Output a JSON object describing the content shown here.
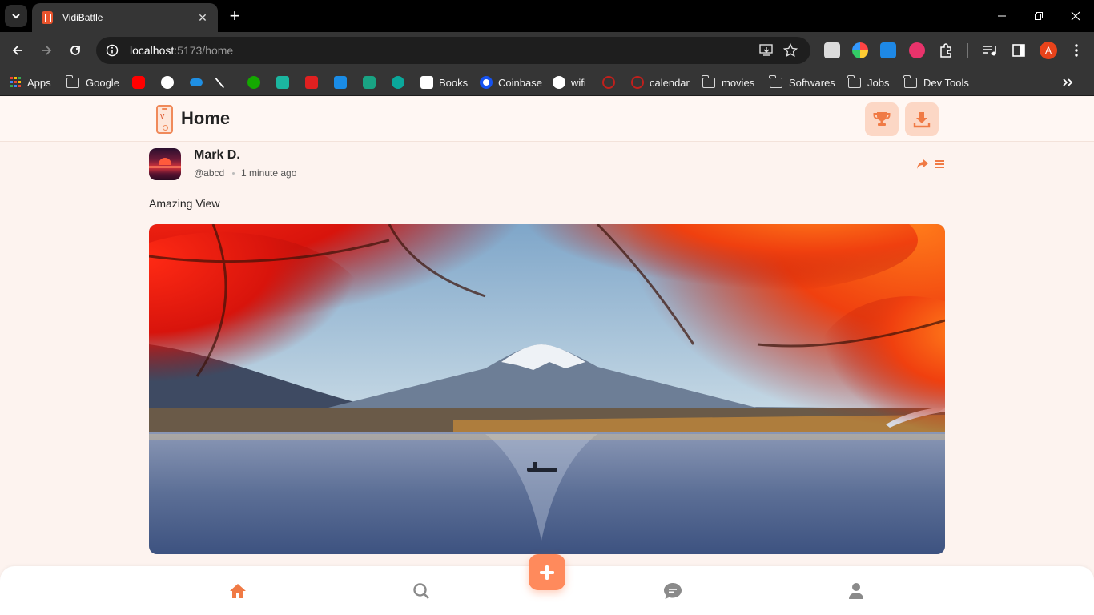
{
  "browser": {
    "tab_title": "VidiBattle",
    "url_host": "localhost",
    "url_rest": ":5173/home",
    "bookmarks": [
      {
        "label": "Apps"
      },
      {
        "label": "Google"
      },
      {
        "label": "Books"
      },
      {
        "label": "Coinbase"
      },
      {
        "label": "wifi"
      },
      {
        "label": "calendar"
      },
      {
        "label": "movies"
      },
      {
        "label": "Softwares"
      },
      {
        "label": "Jobs"
      },
      {
        "label": "Dev Tools"
      }
    ],
    "profile_initial": "A"
  },
  "header": {
    "title": "Home",
    "logo_text": "Vi\nBt"
  },
  "post": {
    "author_name": "Mark D.",
    "author_handle": "@abcd",
    "time_ago": "1 minute ago",
    "caption": "Amazing View"
  },
  "colors": {
    "accent": "#ff8a5c",
    "accent_soft": "#fcd7c5",
    "page_bg": "#fdf3ef"
  },
  "nav": {
    "active": "home",
    "items": [
      "home",
      "search",
      "create",
      "chat",
      "profile"
    ]
  }
}
